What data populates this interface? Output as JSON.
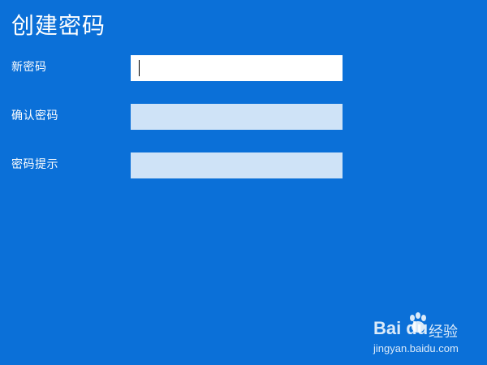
{
  "page": {
    "title": "创建密码"
  },
  "form": {
    "fields": [
      {
        "label": "新密码",
        "value": "",
        "active": true
      },
      {
        "label": "确认密码",
        "value": "",
        "active": false
      },
      {
        "label": "密码提示",
        "value": "",
        "active": false
      }
    ]
  },
  "watermark": {
    "brand_left": "Bai",
    "brand_right": "du",
    "suffix": "经验",
    "url": "jingyan.baidu.com"
  },
  "colors": {
    "background": "#0b70d8",
    "field_active": "#ffffff",
    "field_inactive": "#cfe3f7",
    "text": "#ffffff"
  }
}
